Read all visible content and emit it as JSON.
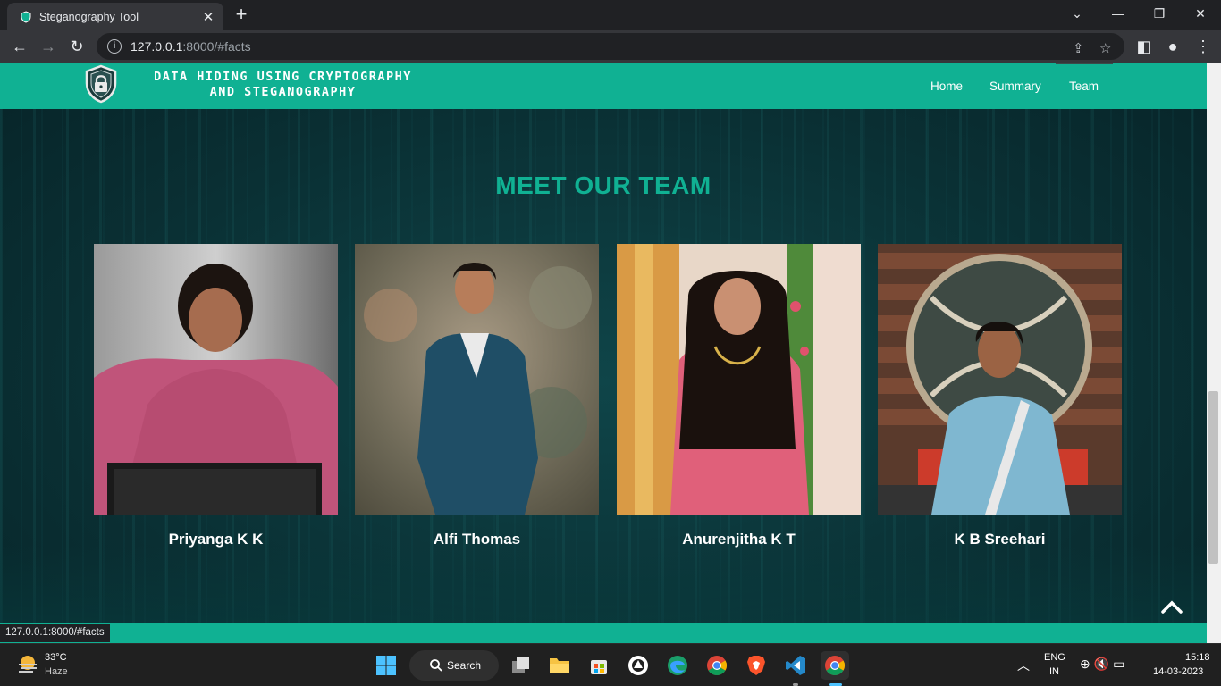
{
  "browser": {
    "tab_title": "Steganography Tool",
    "tab_close": "✕",
    "new_tab": "+",
    "url_host": "127.0.0.1",
    "url_rest": ":8000/#facts",
    "status_url": "127.0.0.1:8000/#facts"
  },
  "site": {
    "brand_line1": "Data Hiding using Cryptography",
    "brand_line2": "and Steganography",
    "nav": [
      "Home",
      "Summary",
      "Team"
    ],
    "active_nav": "Team"
  },
  "team": {
    "heading": "MEET OUR TEAM",
    "members": [
      {
        "name": "Priyanga K K"
      },
      {
        "name": "Alfi Thomas"
      },
      {
        "name": "Anurenjitha K T"
      },
      {
        "name": "K B Sreehari"
      }
    ]
  },
  "taskbar": {
    "weather_temp": "33°C",
    "weather_desc": "Haze",
    "search_label": "Search",
    "lang_line1": "ENG",
    "lang_line2": "IN",
    "time": "15:18",
    "date": "14-03-2023"
  },
  "colors": {
    "accent": "#10b193",
    "page_bg": "#0b3337",
    "browser_dark": "#202124"
  }
}
